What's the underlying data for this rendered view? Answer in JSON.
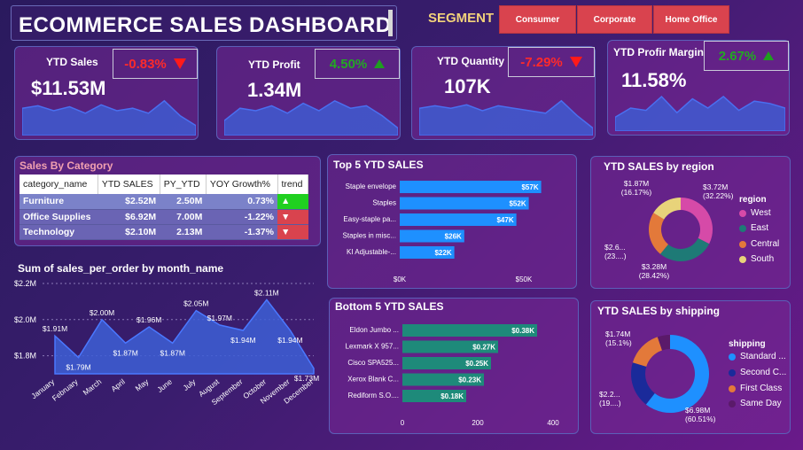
{
  "header": {
    "title": "ECOMMERCE SALES DASHBOARD",
    "segment_label": "SEGMENT",
    "segments": [
      "Consumer",
      "Corporate",
      "Home Office"
    ]
  },
  "kpis": [
    {
      "label": "YTD Sales",
      "value": "$11.53M",
      "change": "-0.83%",
      "direction": "down",
      "spark": [
        0.55,
        0.6,
        0.5,
        0.58,
        0.45,
        0.62,
        0.5,
        0.55,
        0.45,
        0.7,
        0.4,
        0.2
      ]
    },
    {
      "label": "YTD Profit",
      "value": "1.34M",
      "change": "4.50%",
      "direction": "up",
      "spark": [
        0.3,
        0.55,
        0.5,
        0.6,
        0.45,
        0.65,
        0.5,
        0.7,
        0.55,
        0.6,
        0.4,
        0.15
      ]
    },
    {
      "label": "YTD Quantity",
      "value": "107K",
      "change": "-7.29%",
      "direction": "down",
      "spark": [
        0.55,
        0.6,
        0.55,
        0.62,
        0.5,
        0.6,
        0.55,
        0.5,
        0.45,
        0.7,
        0.4,
        0.15
      ]
    },
    {
      "label": "YTD Profir Margin",
      "value": "11.58%",
      "change": "2.67%",
      "direction": "up",
      "spark": [
        0.3,
        0.5,
        0.45,
        0.75,
        0.4,
        0.7,
        0.5,
        0.75,
        0.45,
        0.65,
        0.6,
        0.5
      ]
    }
  ],
  "category_table": {
    "title": "Sales By Category",
    "columns": [
      "category_name",
      "YTD SALES",
      "PY_YTD",
      "YOY Growth%",
      "trend"
    ],
    "rows": [
      {
        "category": "Furniture",
        "ytd": "$2.52M",
        "py": "2.50M",
        "yoy": "0.73%",
        "trend": "up"
      },
      {
        "category": "Office Supplies",
        "ytd": "$6.92M",
        "py": "7.00M",
        "yoy": "-1.22%",
        "trend": "down"
      },
      {
        "category": "Technology",
        "ytd": "$2.10M",
        "py": "2.13M",
        "yoy": "-1.37%",
        "trend": "down"
      }
    ]
  },
  "colors": {
    "bar_blue": "#1e90ff",
    "bar_teal": "#1e8a7a",
    "area": "#3d5fd6",
    "west": "#d64aa8",
    "east": "#1e7a76",
    "central": "#e3793a",
    "south": "#e8d37a",
    "standard": "#1e90ff",
    "second": "#1a2a9a",
    "first": "#e3793a",
    "same": "#5a1a6a"
  },
  "chart_data": [
    {
      "type": "area",
      "title": "Sum of sales_per_order by month_name",
      "categories": [
        "January",
        "February",
        "March",
        "April",
        "May",
        "June",
        "July",
        "August",
        "September",
        "October",
        "November",
        "December"
      ],
      "values": [
        1.91,
        1.79,
        2.0,
        1.87,
        1.96,
        1.87,
        2.05,
        1.97,
        1.94,
        2.11,
        1.94,
        1.73
      ],
      "labels": [
        "$1.91M",
        "$1.79M",
        "$2.00M",
        "$1.87M",
        "$1.96M",
        "$1.87M",
        "$2.05M",
        "$1.97M",
        "$1.94M",
        "$2.11M",
        "$1.94M",
        "$1.73M"
      ],
      "y_ticks": [
        "$2.2M",
        "$2.0M",
        "$1.8M"
      ],
      "ylim": [
        1.7,
        2.2
      ]
    },
    {
      "type": "bar",
      "title": "Top 5 YTD SALES",
      "categories": [
        "Staple envelope",
        "Staples",
        "Easy-staple pa...",
        "Staples in misc...",
        "KI Adjustable-..."
      ],
      "values": [
        57,
        52,
        47,
        26,
        22
      ],
      "labels": [
        "$57K",
        "$52K",
        "$47K",
        "$26K",
        "$22K"
      ],
      "x_ticks": [
        "$0K",
        "$50K"
      ],
      "xlim": [
        0,
        70
      ]
    },
    {
      "type": "bar",
      "title": "Bottom 5 YTD SALES",
      "categories": [
        "Eldon Jumbo ...",
        "Lexmark X 957...",
        "Cisco SPA525...",
        "Xerox Blank C...",
        "Rediform S.O...."
      ],
      "values": [
        0.38,
        0.27,
        0.25,
        0.23,
        0.18
      ],
      "labels": [
        "$0.38K",
        "$0.27K",
        "$0.25K",
        "$0.23K",
        "$0.18K"
      ],
      "x_ticks": [
        "0",
        "200",
        "400"
      ],
      "xlim": [
        0,
        0.4
      ]
    },
    {
      "type": "pie",
      "title": "YTD SALES by region",
      "legend_title": "region",
      "categories": [
        "West",
        "East",
        "Central",
        "South"
      ],
      "values": [
        3.72,
        3.28,
        2.6,
        1.87
      ],
      "labels": [
        [
          "$3.72M",
          "(32.22%)"
        ],
        [
          "$3.28M",
          "(28.42%)"
        ],
        [
          "$2.6...",
          "(23....)"
        ],
        [
          "$1.87M",
          "(16.17%)"
        ]
      ]
    },
    {
      "type": "pie",
      "title": "YTD SALES by shipping",
      "legend_title": "shipping",
      "categories": [
        "Standard ...",
        "Second C...",
        "First Class",
        "Same Day"
      ],
      "values": [
        6.98,
        2.2,
        1.74,
        0.6
      ],
      "labels": [
        [
          "$6.98M",
          "(60.51%)"
        ],
        [
          "$2.2...",
          "(19....)"
        ],
        [
          "$1.74M",
          "(15.1%)"
        ],
        [
          "",
          ""
        ]
      ]
    }
  ]
}
